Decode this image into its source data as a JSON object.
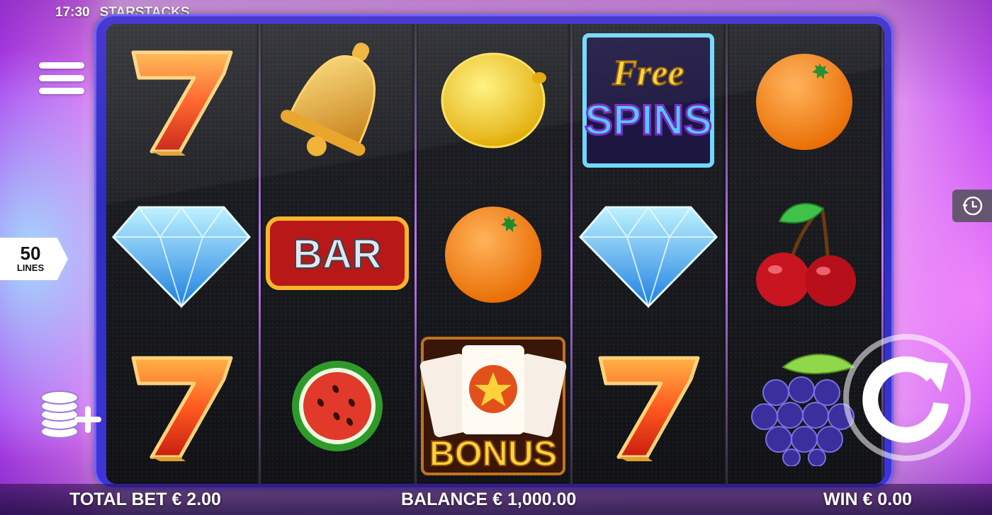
{
  "status_bar": {
    "time": "17:30",
    "game_title": "STARSTACKS"
  },
  "lines": {
    "count": "50",
    "label": "LINES"
  },
  "reels": [
    [
      "seven",
      "diamond",
      "seven"
    ],
    [
      "bell",
      "bar",
      "watermelon"
    ],
    [
      "lemon",
      "orange",
      "bonus"
    ],
    [
      "free-spins",
      "diamond",
      "seven"
    ],
    [
      "orange",
      "cherries",
      "grapes"
    ]
  ],
  "symbol_text": {
    "bar": "BAR",
    "free_top": "Free",
    "free_bottom": "SPINS",
    "bonus": "BONUS"
  },
  "footer": {
    "total_bet": "TOTAL BET € 2.00",
    "balance": "BALANCE € 1,000.00",
    "win": "WIN € 0.00"
  },
  "icons": {
    "menu": "hamburger-icon",
    "coins": "coin-stack-plus-icon",
    "history": "history-clock-icon",
    "spin": "spin-arrow-icon"
  },
  "colors": {
    "frame": "#3a33d0",
    "reel_bg": "#15161c",
    "accent_purple": "#c14cf2"
  }
}
